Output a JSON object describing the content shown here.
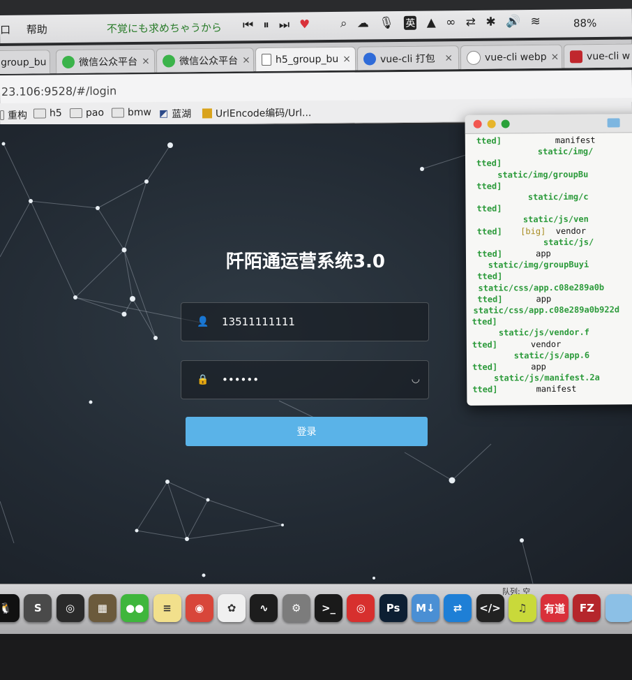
{
  "menubar": {
    "menu_items": [
      "口",
      "帮助"
    ],
    "now_playing": "不覚にも求めちゃうから",
    "controls": [
      "⏮",
      "⏸",
      "⏭"
    ],
    "battery": "88%"
  },
  "tabs": [
    {
      "label": "group_bu",
      "icon_color": "#cfcfcf"
    },
    {
      "label": "微信公众平台",
      "icon_color": "#3bb34a"
    },
    {
      "label": "微信公众平台",
      "icon_color": "#3bb34a"
    },
    {
      "label": "h5_group_bu",
      "icon_color": "#ffffff"
    },
    {
      "label": "vue-cli 打包",
      "icon_color": "#2f6bd8"
    },
    {
      "label": "vue-cli webp",
      "icon_color": "#ffffff"
    },
    {
      "label": "vue-cli w",
      "icon_color": "#c0272d"
    }
  ],
  "address": {
    "url": "23.106:9528/#/login"
  },
  "bookmarks": [
    "重构",
    "h5",
    "pao",
    "bmw",
    "蓝湖",
    "UrlEncode编码/Url..."
  ],
  "login": {
    "title": "阡陌通运营系统3.0",
    "username": "13511111111",
    "password": "••••••",
    "submit": "登录"
  },
  "terminal": {
    "lines": [
      {
        "prefix": "tted]",
        "text": "         manifest",
        "cls": "k"
      },
      {
        "prefix": "",
        "text": "             static/img/",
        "cls": "g"
      },
      {
        "prefix": "tted]",
        "text": "",
        "cls": "k"
      },
      {
        "prefix": "",
        "text": "     static/img/groupBu",
        "cls": "g"
      },
      {
        "prefix": "tted]",
        "text": "",
        "cls": "k"
      },
      {
        "prefix": "",
        "text": "           static/img/c",
        "cls": "g"
      },
      {
        "prefix": "tted]",
        "text": "",
        "cls": "k"
      },
      {
        "prefix": "",
        "text": "          static/js/ven",
        "cls": "g"
      },
      {
        "prefix": "tted]",
        "text": "  [big]  vendor",
        "cls": "k"
      },
      {
        "prefix": "",
        "text": "              static/js/",
        "cls": "g"
      },
      {
        "prefix": "tted]",
        "text": "     app",
        "cls": "k"
      },
      {
        "prefix": "",
        "text": "   static/img/groupBuyi",
        "cls": "g"
      },
      {
        "prefix": "tted]",
        "text": "",
        "cls": "k"
      },
      {
        "prefix": "",
        "text": " static/css/app.c08e289a0b",
        "cls": "g"
      },
      {
        "prefix": "tted]",
        "text": "     app",
        "cls": "k"
      },
      {
        "prefix": "",
        "text": "static/css/app.c08e289a0b922d",
        "cls": "g"
      },
      {
        "prefix": "tted]",
        "text": "",
        "cls": "k"
      },
      {
        "prefix": "",
        "text": "     static/js/vendor.f",
        "cls": "g"
      },
      {
        "prefix": "tted]",
        "text": "     vendor",
        "cls": "k"
      },
      {
        "prefix": "",
        "text": "        static/js/app.6",
        "cls": "g"
      },
      {
        "prefix": "tted]",
        "text": "     app",
        "cls": "k"
      },
      {
        "prefix": "",
        "text": "    static/js/manifest.2a",
        "cls": "g"
      },
      {
        "prefix": "tted]",
        "text": "      manifest",
        "cls": "k"
      }
    ]
  },
  "dock": {
    "queue_label": "队列: 空",
    "apps": [
      {
        "name": "qq-icon",
        "label": "🐧",
        "color": "#111111"
      },
      {
        "name": "sublime-text-icon",
        "label": "S",
        "color": "#4a4a4a"
      },
      {
        "name": "instruments-icon",
        "label": "◎",
        "color": "#2a2a2a"
      },
      {
        "name": "calculator-icon",
        "label": "▦",
        "color": "#6b5a3c"
      },
      {
        "name": "wechat-icon",
        "label": "●●",
        "color": "#3fb63c"
      },
      {
        "name": "notes-icon",
        "label": "≡",
        "color": "#f2e08c"
      },
      {
        "name": "chrome-icon",
        "label": "◉",
        "color": "#d8463a"
      },
      {
        "name": "photos-icon",
        "label": "✿",
        "color": "#f0f0f0"
      },
      {
        "name": "activity-monitor-icon",
        "label": "∿",
        "color": "#1d1d1d"
      },
      {
        "name": "system-preferences-icon",
        "label": "⚙",
        "color": "#7c7c7c"
      },
      {
        "name": "terminal-icon",
        "label": ">_",
        "color": "#1a1a1a"
      },
      {
        "name": "netease-music-icon",
        "label": "◎",
        "color": "#d7302e"
      },
      {
        "name": "photoshop-icon",
        "label": "Ps",
        "color": "#0d1f33"
      },
      {
        "name": "markdown-icon",
        "label": "M↓",
        "color": "#4a8fd4"
      },
      {
        "name": "teamviewer-icon",
        "label": "⇄",
        "color": "#1e7fd6"
      },
      {
        "name": "code-editor-icon",
        "label": "</>",
        "color": "#222222"
      },
      {
        "name": "music-player-icon",
        "label": "♫",
        "color": "#c9d93a"
      },
      {
        "name": "youdao-icon",
        "label": "有道",
        "color": "#d9303a"
      },
      {
        "name": "filezilla-icon",
        "label": "FZ",
        "color": "#b5262b"
      },
      {
        "name": "finder-folder-icon",
        "label": "",
        "color": "#8cc0e6"
      }
    ]
  }
}
